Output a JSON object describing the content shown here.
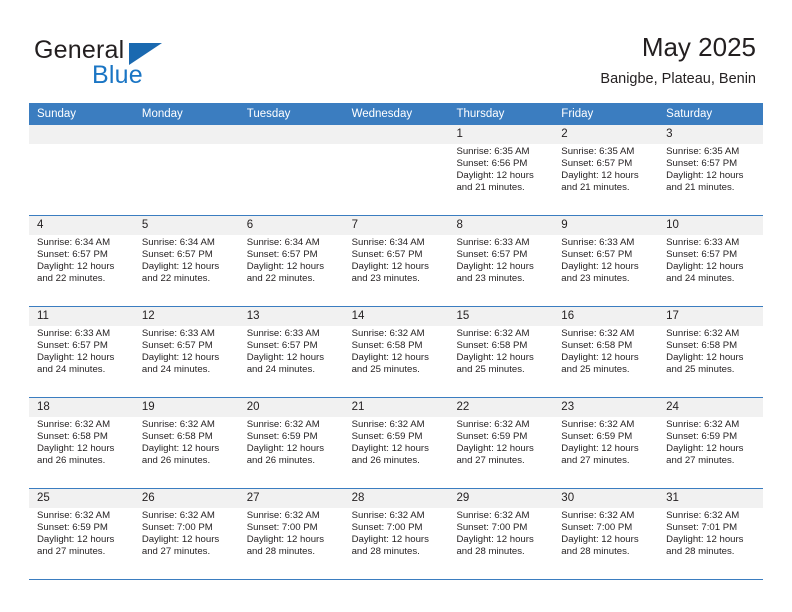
{
  "logo": {
    "word1": "General",
    "word2": "Blue",
    "triangle_color": "#1a69b0",
    "blue_text_color": "#1a75c4"
  },
  "header": {
    "title": "May 2025",
    "subtitle": "Banigbe, Plateau, Benin",
    "accent_color": "#3b7dc0",
    "daynum_band_color": "#f1f1f1"
  },
  "weekdays": [
    "Sunday",
    "Monday",
    "Tuesday",
    "Wednesday",
    "Thursday",
    "Friday",
    "Saturday"
  ],
  "labels": {
    "sunrise_prefix": "Sunrise:",
    "sunset_prefix": "Sunset:",
    "daylight_prefix": "Daylight:"
  },
  "weeks": [
    {
      "days": [
        {
          "num": "",
          "empty": true
        },
        {
          "num": "",
          "empty": true
        },
        {
          "num": "",
          "empty": true
        },
        {
          "num": "",
          "empty": true
        },
        {
          "num": "1",
          "sunrise": "Sunrise: 6:35 AM",
          "sunset": "Sunset: 6:56 PM",
          "daylight_line1": "Daylight: 12 hours",
          "daylight_line2": "and 21 minutes."
        },
        {
          "num": "2",
          "sunrise": "Sunrise: 6:35 AM",
          "sunset": "Sunset: 6:57 PM",
          "daylight_line1": "Daylight: 12 hours",
          "daylight_line2": "and 21 minutes."
        },
        {
          "num": "3",
          "sunrise": "Sunrise: 6:35 AM",
          "sunset": "Sunset: 6:57 PM",
          "daylight_line1": "Daylight: 12 hours",
          "daylight_line2": "and 21 minutes."
        }
      ]
    },
    {
      "days": [
        {
          "num": "4",
          "sunrise": "Sunrise: 6:34 AM",
          "sunset": "Sunset: 6:57 PM",
          "daylight_line1": "Daylight: 12 hours",
          "daylight_line2": "and 22 minutes."
        },
        {
          "num": "5",
          "sunrise": "Sunrise: 6:34 AM",
          "sunset": "Sunset: 6:57 PM",
          "daylight_line1": "Daylight: 12 hours",
          "daylight_line2": "and 22 minutes."
        },
        {
          "num": "6",
          "sunrise": "Sunrise: 6:34 AM",
          "sunset": "Sunset: 6:57 PM",
          "daylight_line1": "Daylight: 12 hours",
          "daylight_line2": "and 22 minutes."
        },
        {
          "num": "7",
          "sunrise": "Sunrise: 6:34 AM",
          "sunset": "Sunset: 6:57 PM",
          "daylight_line1": "Daylight: 12 hours",
          "daylight_line2": "and 23 minutes."
        },
        {
          "num": "8",
          "sunrise": "Sunrise: 6:33 AM",
          "sunset": "Sunset: 6:57 PM",
          "daylight_line1": "Daylight: 12 hours",
          "daylight_line2": "and 23 minutes."
        },
        {
          "num": "9",
          "sunrise": "Sunrise: 6:33 AM",
          "sunset": "Sunset: 6:57 PM",
          "daylight_line1": "Daylight: 12 hours",
          "daylight_line2": "and 23 minutes."
        },
        {
          "num": "10",
          "sunrise": "Sunrise: 6:33 AM",
          "sunset": "Sunset: 6:57 PM",
          "daylight_line1": "Daylight: 12 hours",
          "daylight_line2": "and 24 minutes."
        }
      ]
    },
    {
      "days": [
        {
          "num": "11",
          "sunrise": "Sunrise: 6:33 AM",
          "sunset": "Sunset: 6:57 PM",
          "daylight_line1": "Daylight: 12 hours",
          "daylight_line2": "and 24 minutes."
        },
        {
          "num": "12",
          "sunrise": "Sunrise: 6:33 AM",
          "sunset": "Sunset: 6:57 PM",
          "daylight_line1": "Daylight: 12 hours",
          "daylight_line2": "and 24 minutes."
        },
        {
          "num": "13",
          "sunrise": "Sunrise: 6:33 AM",
          "sunset": "Sunset: 6:57 PM",
          "daylight_line1": "Daylight: 12 hours",
          "daylight_line2": "and 24 minutes."
        },
        {
          "num": "14",
          "sunrise": "Sunrise: 6:32 AM",
          "sunset": "Sunset: 6:58 PM",
          "daylight_line1": "Daylight: 12 hours",
          "daylight_line2": "and 25 minutes."
        },
        {
          "num": "15",
          "sunrise": "Sunrise: 6:32 AM",
          "sunset": "Sunset: 6:58 PM",
          "daylight_line1": "Daylight: 12 hours",
          "daylight_line2": "and 25 minutes."
        },
        {
          "num": "16",
          "sunrise": "Sunrise: 6:32 AM",
          "sunset": "Sunset: 6:58 PM",
          "daylight_line1": "Daylight: 12 hours",
          "daylight_line2": "and 25 minutes."
        },
        {
          "num": "17",
          "sunrise": "Sunrise: 6:32 AM",
          "sunset": "Sunset: 6:58 PM",
          "daylight_line1": "Daylight: 12 hours",
          "daylight_line2": "and 25 minutes."
        }
      ]
    },
    {
      "days": [
        {
          "num": "18",
          "sunrise": "Sunrise: 6:32 AM",
          "sunset": "Sunset: 6:58 PM",
          "daylight_line1": "Daylight: 12 hours",
          "daylight_line2": "and 26 minutes."
        },
        {
          "num": "19",
          "sunrise": "Sunrise: 6:32 AM",
          "sunset": "Sunset: 6:58 PM",
          "daylight_line1": "Daylight: 12 hours",
          "daylight_line2": "and 26 minutes."
        },
        {
          "num": "20",
          "sunrise": "Sunrise: 6:32 AM",
          "sunset": "Sunset: 6:59 PM",
          "daylight_line1": "Daylight: 12 hours",
          "daylight_line2": "and 26 minutes."
        },
        {
          "num": "21",
          "sunrise": "Sunrise: 6:32 AM",
          "sunset": "Sunset: 6:59 PM",
          "daylight_line1": "Daylight: 12 hours",
          "daylight_line2": "and 26 minutes."
        },
        {
          "num": "22",
          "sunrise": "Sunrise: 6:32 AM",
          "sunset": "Sunset: 6:59 PM",
          "daylight_line1": "Daylight: 12 hours",
          "daylight_line2": "and 27 minutes."
        },
        {
          "num": "23",
          "sunrise": "Sunrise: 6:32 AM",
          "sunset": "Sunset: 6:59 PM",
          "daylight_line1": "Daylight: 12 hours",
          "daylight_line2": "and 27 minutes."
        },
        {
          "num": "24",
          "sunrise": "Sunrise: 6:32 AM",
          "sunset": "Sunset: 6:59 PM",
          "daylight_line1": "Daylight: 12 hours",
          "daylight_line2": "and 27 minutes."
        }
      ]
    },
    {
      "days": [
        {
          "num": "25",
          "sunrise": "Sunrise: 6:32 AM",
          "sunset": "Sunset: 6:59 PM",
          "daylight_line1": "Daylight: 12 hours",
          "daylight_line2": "and 27 minutes."
        },
        {
          "num": "26",
          "sunrise": "Sunrise: 6:32 AM",
          "sunset": "Sunset: 7:00 PM",
          "daylight_line1": "Daylight: 12 hours",
          "daylight_line2": "and 27 minutes."
        },
        {
          "num": "27",
          "sunrise": "Sunrise: 6:32 AM",
          "sunset": "Sunset: 7:00 PM",
          "daylight_line1": "Daylight: 12 hours",
          "daylight_line2": "and 28 minutes."
        },
        {
          "num": "28",
          "sunrise": "Sunrise: 6:32 AM",
          "sunset": "Sunset: 7:00 PM",
          "daylight_line1": "Daylight: 12 hours",
          "daylight_line2": "and 28 minutes."
        },
        {
          "num": "29",
          "sunrise": "Sunrise: 6:32 AM",
          "sunset": "Sunset: 7:00 PM",
          "daylight_line1": "Daylight: 12 hours",
          "daylight_line2": "and 28 minutes."
        },
        {
          "num": "30",
          "sunrise": "Sunrise: 6:32 AM",
          "sunset": "Sunset: 7:00 PM",
          "daylight_line1": "Daylight: 12 hours",
          "daylight_line2": "and 28 minutes."
        },
        {
          "num": "31",
          "sunrise": "Sunrise: 6:32 AM",
          "sunset": "Sunset: 7:01 PM",
          "daylight_line1": "Daylight: 12 hours",
          "daylight_line2": "and 28 minutes."
        }
      ]
    }
  ]
}
